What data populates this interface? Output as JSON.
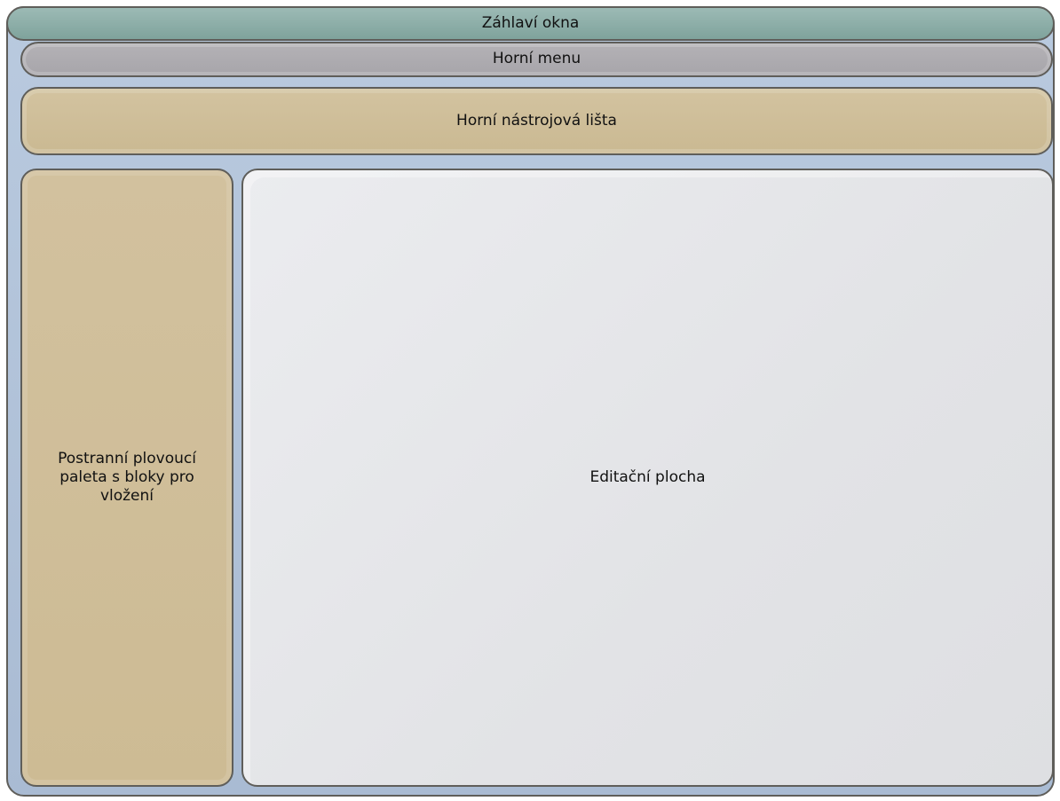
{
  "window": {
    "title": "Záhlaví okna"
  },
  "menu": {
    "label": "Horní menu"
  },
  "toolbar": {
    "label": "Horní nástrojová lišta"
  },
  "palette": {
    "label": "Postranní plovoucí paleta s bloky pro vložení"
  },
  "editor": {
    "label": "Editační plocha"
  },
  "colors": {
    "titlebar": "#8fb0aa",
    "menu": "#adabb0",
    "panels": "#cfbe98",
    "editor": "#e4e5e8",
    "frame": "#afc1d8"
  }
}
